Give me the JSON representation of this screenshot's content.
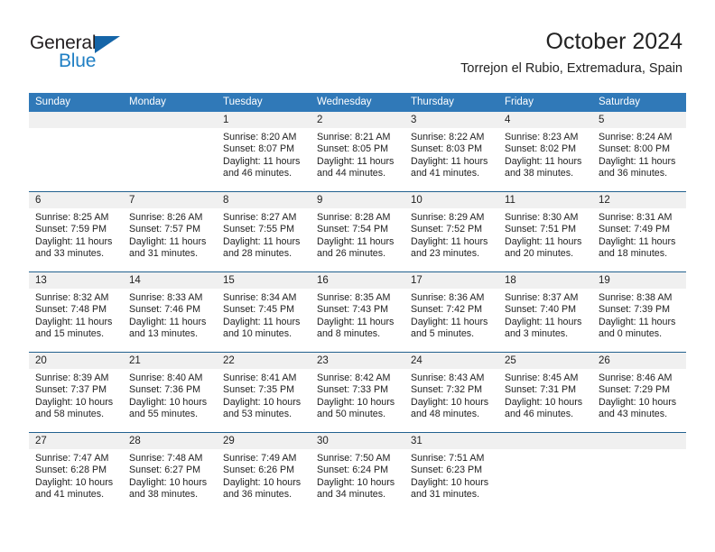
{
  "brand": {
    "name_part1": "General",
    "name_part2": "Blue",
    "accent_color": "#1f7fc4",
    "triangle_color": "#1565a8"
  },
  "header": {
    "title": "October 2024",
    "subtitle": "Torrejon el Rubio, Extremadura, Spain",
    "header_bg_color": "#3079b8",
    "separator_color": "#22618f",
    "day_band_color": "#f0f0f0"
  },
  "weekdays": [
    "Sunday",
    "Monday",
    "Tuesday",
    "Wednesday",
    "Thursday",
    "Friday",
    "Saturday"
  ],
  "weeks": [
    [
      {
        "day": "",
        "lines": []
      },
      {
        "day": "",
        "lines": []
      },
      {
        "day": "1",
        "lines": [
          "Sunrise: 8:20 AM",
          "Sunset: 8:07 PM",
          "Daylight: 11 hours",
          "and 46 minutes."
        ]
      },
      {
        "day": "2",
        "lines": [
          "Sunrise: 8:21 AM",
          "Sunset: 8:05 PM",
          "Daylight: 11 hours",
          "and 44 minutes."
        ]
      },
      {
        "day": "3",
        "lines": [
          "Sunrise: 8:22 AM",
          "Sunset: 8:03 PM",
          "Daylight: 11 hours",
          "and 41 minutes."
        ]
      },
      {
        "day": "4",
        "lines": [
          "Sunrise: 8:23 AM",
          "Sunset: 8:02 PM",
          "Daylight: 11 hours",
          "and 38 minutes."
        ]
      },
      {
        "day": "5",
        "lines": [
          "Sunrise: 8:24 AM",
          "Sunset: 8:00 PM",
          "Daylight: 11 hours",
          "and 36 minutes."
        ]
      }
    ],
    [
      {
        "day": "6",
        "lines": [
          "Sunrise: 8:25 AM",
          "Sunset: 7:59 PM",
          "Daylight: 11 hours",
          "and 33 minutes."
        ]
      },
      {
        "day": "7",
        "lines": [
          "Sunrise: 8:26 AM",
          "Sunset: 7:57 PM",
          "Daylight: 11 hours",
          "and 31 minutes."
        ]
      },
      {
        "day": "8",
        "lines": [
          "Sunrise: 8:27 AM",
          "Sunset: 7:55 PM",
          "Daylight: 11 hours",
          "and 28 minutes."
        ]
      },
      {
        "day": "9",
        "lines": [
          "Sunrise: 8:28 AM",
          "Sunset: 7:54 PM",
          "Daylight: 11 hours",
          "and 26 minutes."
        ]
      },
      {
        "day": "10",
        "lines": [
          "Sunrise: 8:29 AM",
          "Sunset: 7:52 PM",
          "Daylight: 11 hours",
          "and 23 minutes."
        ]
      },
      {
        "day": "11",
        "lines": [
          "Sunrise: 8:30 AM",
          "Sunset: 7:51 PM",
          "Daylight: 11 hours",
          "and 20 minutes."
        ]
      },
      {
        "day": "12",
        "lines": [
          "Sunrise: 8:31 AM",
          "Sunset: 7:49 PM",
          "Daylight: 11 hours",
          "and 18 minutes."
        ]
      }
    ],
    [
      {
        "day": "13",
        "lines": [
          "Sunrise: 8:32 AM",
          "Sunset: 7:48 PM",
          "Daylight: 11 hours",
          "and 15 minutes."
        ]
      },
      {
        "day": "14",
        "lines": [
          "Sunrise: 8:33 AM",
          "Sunset: 7:46 PM",
          "Daylight: 11 hours",
          "and 13 minutes."
        ]
      },
      {
        "day": "15",
        "lines": [
          "Sunrise: 8:34 AM",
          "Sunset: 7:45 PM",
          "Daylight: 11 hours",
          "and 10 minutes."
        ]
      },
      {
        "day": "16",
        "lines": [
          "Sunrise: 8:35 AM",
          "Sunset: 7:43 PM",
          "Daylight: 11 hours",
          "and 8 minutes."
        ]
      },
      {
        "day": "17",
        "lines": [
          "Sunrise: 8:36 AM",
          "Sunset: 7:42 PM",
          "Daylight: 11 hours",
          "and 5 minutes."
        ]
      },
      {
        "day": "18",
        "lines": [
          "Sunrise: 8:37 AM",
          "Sunset: 7:40 PM",
          "Daylight: 11 hours",
          "and 3 minutes."
        ]
      },
      {
        "day": "19",
        "lines": [
          "Sunrise: 8:38 AM",
          "Sunset: 7:39 PM",
          "Daylight: 11 hours",
          "and 0 minutes."
        ]
      }
    ],
    [
      {
        "day": "20",
        "lines": [
          "Sunrise: 8:39 AM",
          "Sunset: 7:37 PM",
          "Daylight: 10 hours",
          "and 58 minutes."
        ]
      },
      {
        "day": "21",
        "lines": [
          "Sunrise: 8:40 AM",
          "Sunset: 7:36 PM",
          "Daylight: 10 hours",
          "and 55 minutes."
        ]
      },
      {
        "day": "22",
        "lines": [
          "Sunrise: 8:41 AM",
          "Sunset: 7:35 PM",
          "Daylight: 10 hours",
          "and 53 minutes."
        ]
      },
      {
        "day": "23",
        "lines": [
          "Sunrise: 8:42 AM",
          "Sunset: 7:33 PM",
          "Daylight: 10 hours",
          "and 50 minutes."
        ]
      },
      {
        "day": "24",
        "lines": [
          "Sunrise: 8:43 AM",
          "Sunset: 7:32 PM",
          "Daylight: 10 hours",
          "and 48 minutes."
        ]
      },
      {
        "day": "25",
        "lines": [
          "Sunrise: 8:45 AM",
          "Sunset: 7:31 PM",
          "Daylight: 10 hours",
          "and 46 minutes."
        ]
      },
      {
        "day": "26",
        "lines": [
          "Sunrise: 8:46 AM",
          "Sunset: 7:29 PM",
          "Daylight: 10 hours",
          "and 43 minutes."
        ]
      }
    ],
    [
      {
        "day": "27",
        "lines": [
          "Sunrise: 7:47 AM",
          "Sunset: 6:28 PM",
          "Daylight: 10 hours",
          "and 41 minutes."
        ]
      },
      {
        "day": "28",
        "lines": [
          "Sunrise: 7:48 AM",
          "Sunset: 6:27 PM",
          "Daylight: 10 hours",
          "and 38 minutes."
        ]
      },
      {
        "day": "29",
        "lines": [
          "Sunrise: 7:49 AM",
          "Sunset: 6:26 PM",
          "Daylight: 10 hours",
          "and 36 minutes."
        ]
      },
      {
        "day": "30",
        "lines": [
          "Sunrise: 7:50 AM",
          "Sunset: 6:24 PM",
          "Daylight: 10 hours",
          "and 34 minutes."
        ]
      },
      {
        "day": "31",
        "lines": [
          "Sunrise: 7:51 AM",
          "Sunset: 6:23 PM",
          "Daylight: 10 hours",
          "and 31 minutes."
        ]
      },
      {
        "day": "",
        "lines": []
      },
      {
        "day": "",
        "lines": []
      }
    ]
  ]
}
